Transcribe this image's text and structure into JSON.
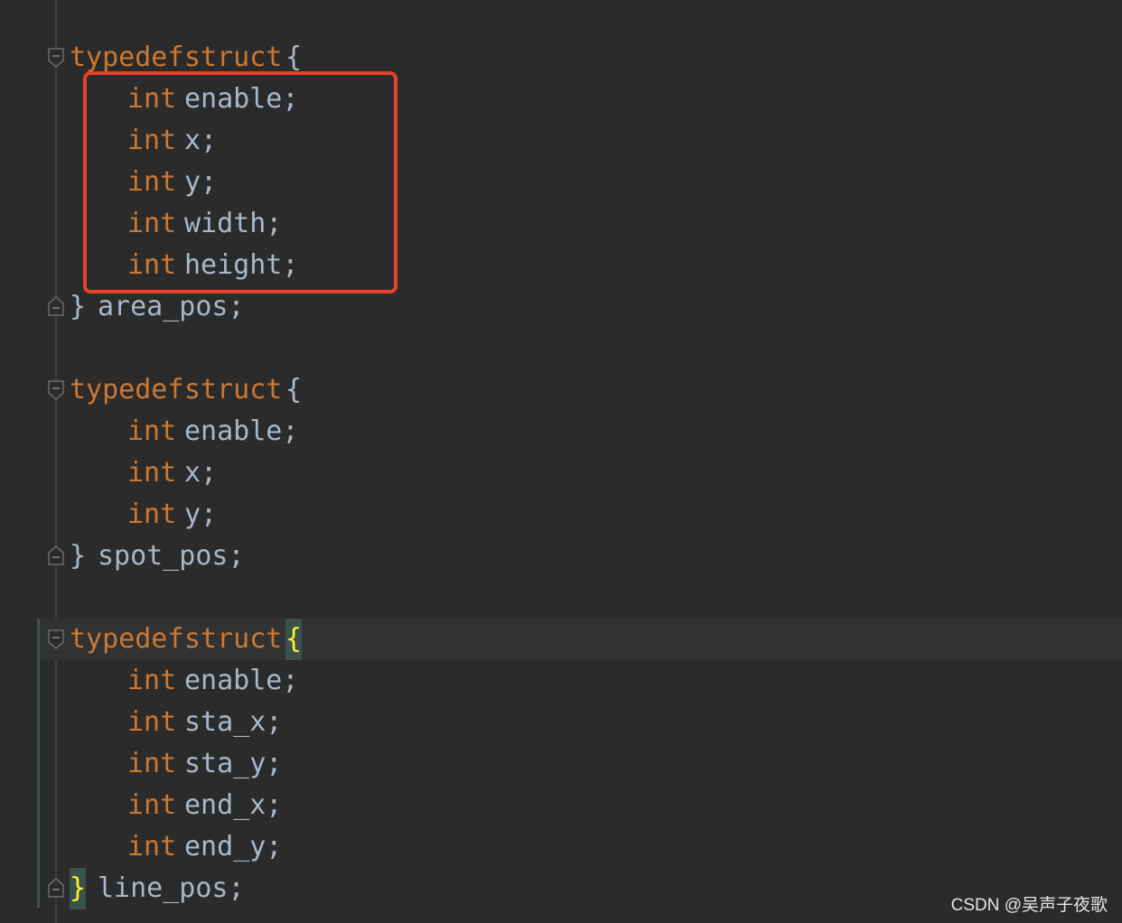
{
  "code": {
    "keywords": {
      "typedef": "typedef",
      "struct": "struct",
      "int": "int"
    },
    "open_brace": "{",
    "close_brace": "}",
    "structs": [
      {
        "name": "area_pos;",
        "fields": [
          "enable;",
          "x;",
          "y;",
          "width;",
          "height;"
        ]
      },
      {
        "name": "spot_pos;",
        "fields": [
          "enable;",
          "x;",
          "y;"
        ]
      },
      {
        "name": "line_pos;",
        "fields": [
          "enable;",
          "sta_x;",
          "sta_y;",
          "end_x;",
          "end_y;"
        ]
      }
    ]
  },
  "annotation": {
    "color": "#e8412c",
    "target": "area_pos fields"
  },
  "theme": {
    "background": "#2b2b2b",
    "keyword": "#cc7832",
    "identifier": "#a9b7c6",
    "current_line": "#323232",
    "brace_match_bg": "#3b514d"
  },
  "watermark": "CSDN @吴声子夜歌"
}
